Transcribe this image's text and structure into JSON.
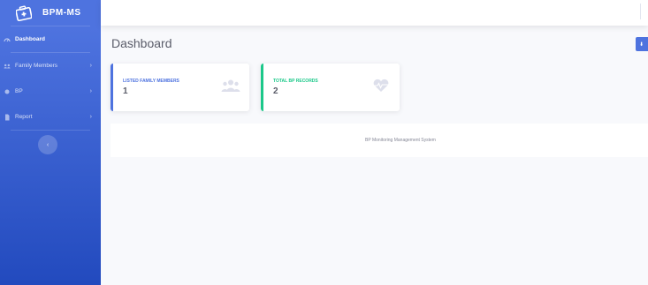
{
  "brand": {
    "name": "BPM-MS"
  },
  "sidebar": {
    "items": [
      {
        "label": "Dashboard",
        "icon": "tachometer-icon",
        "active": true
      },
      {
        "label": "Family Members",
        "icon": "users-icon",
        "has_submenu": true
      },
      {
        "label": "BP",
        "icon": "heartbeat-icon",
        "has_submenu": true
      },
      {
        "label": "Report",
        "icon": "file-icon",
        "has_submenu": true
      }
    ],
    "toggle_icon": "chevron-left-icon"
  },
  "header": {
    "title": "Dashboard"
  },
  "cards": [
    {
      "title": "LISTED FAMILY MEMBERS",
      "value": "1",
      "icon": "users-icon",
      "color": "#4e73df"
    },
    {
      "title": "TOTAL BP RECORDS",
      "value": "2",
      "icon": "heartbeat-icon",
      "color": "#1cc88a"
    }
  ],
  "footer": {
    "text": "BP Monitoring Management System"
  },
  "colors": {
    "primary": "#4e73df",
    "success": "#1cc88a",
    "text": "#5a5c69",
    "background": "#f8f9fc"
  }
}
